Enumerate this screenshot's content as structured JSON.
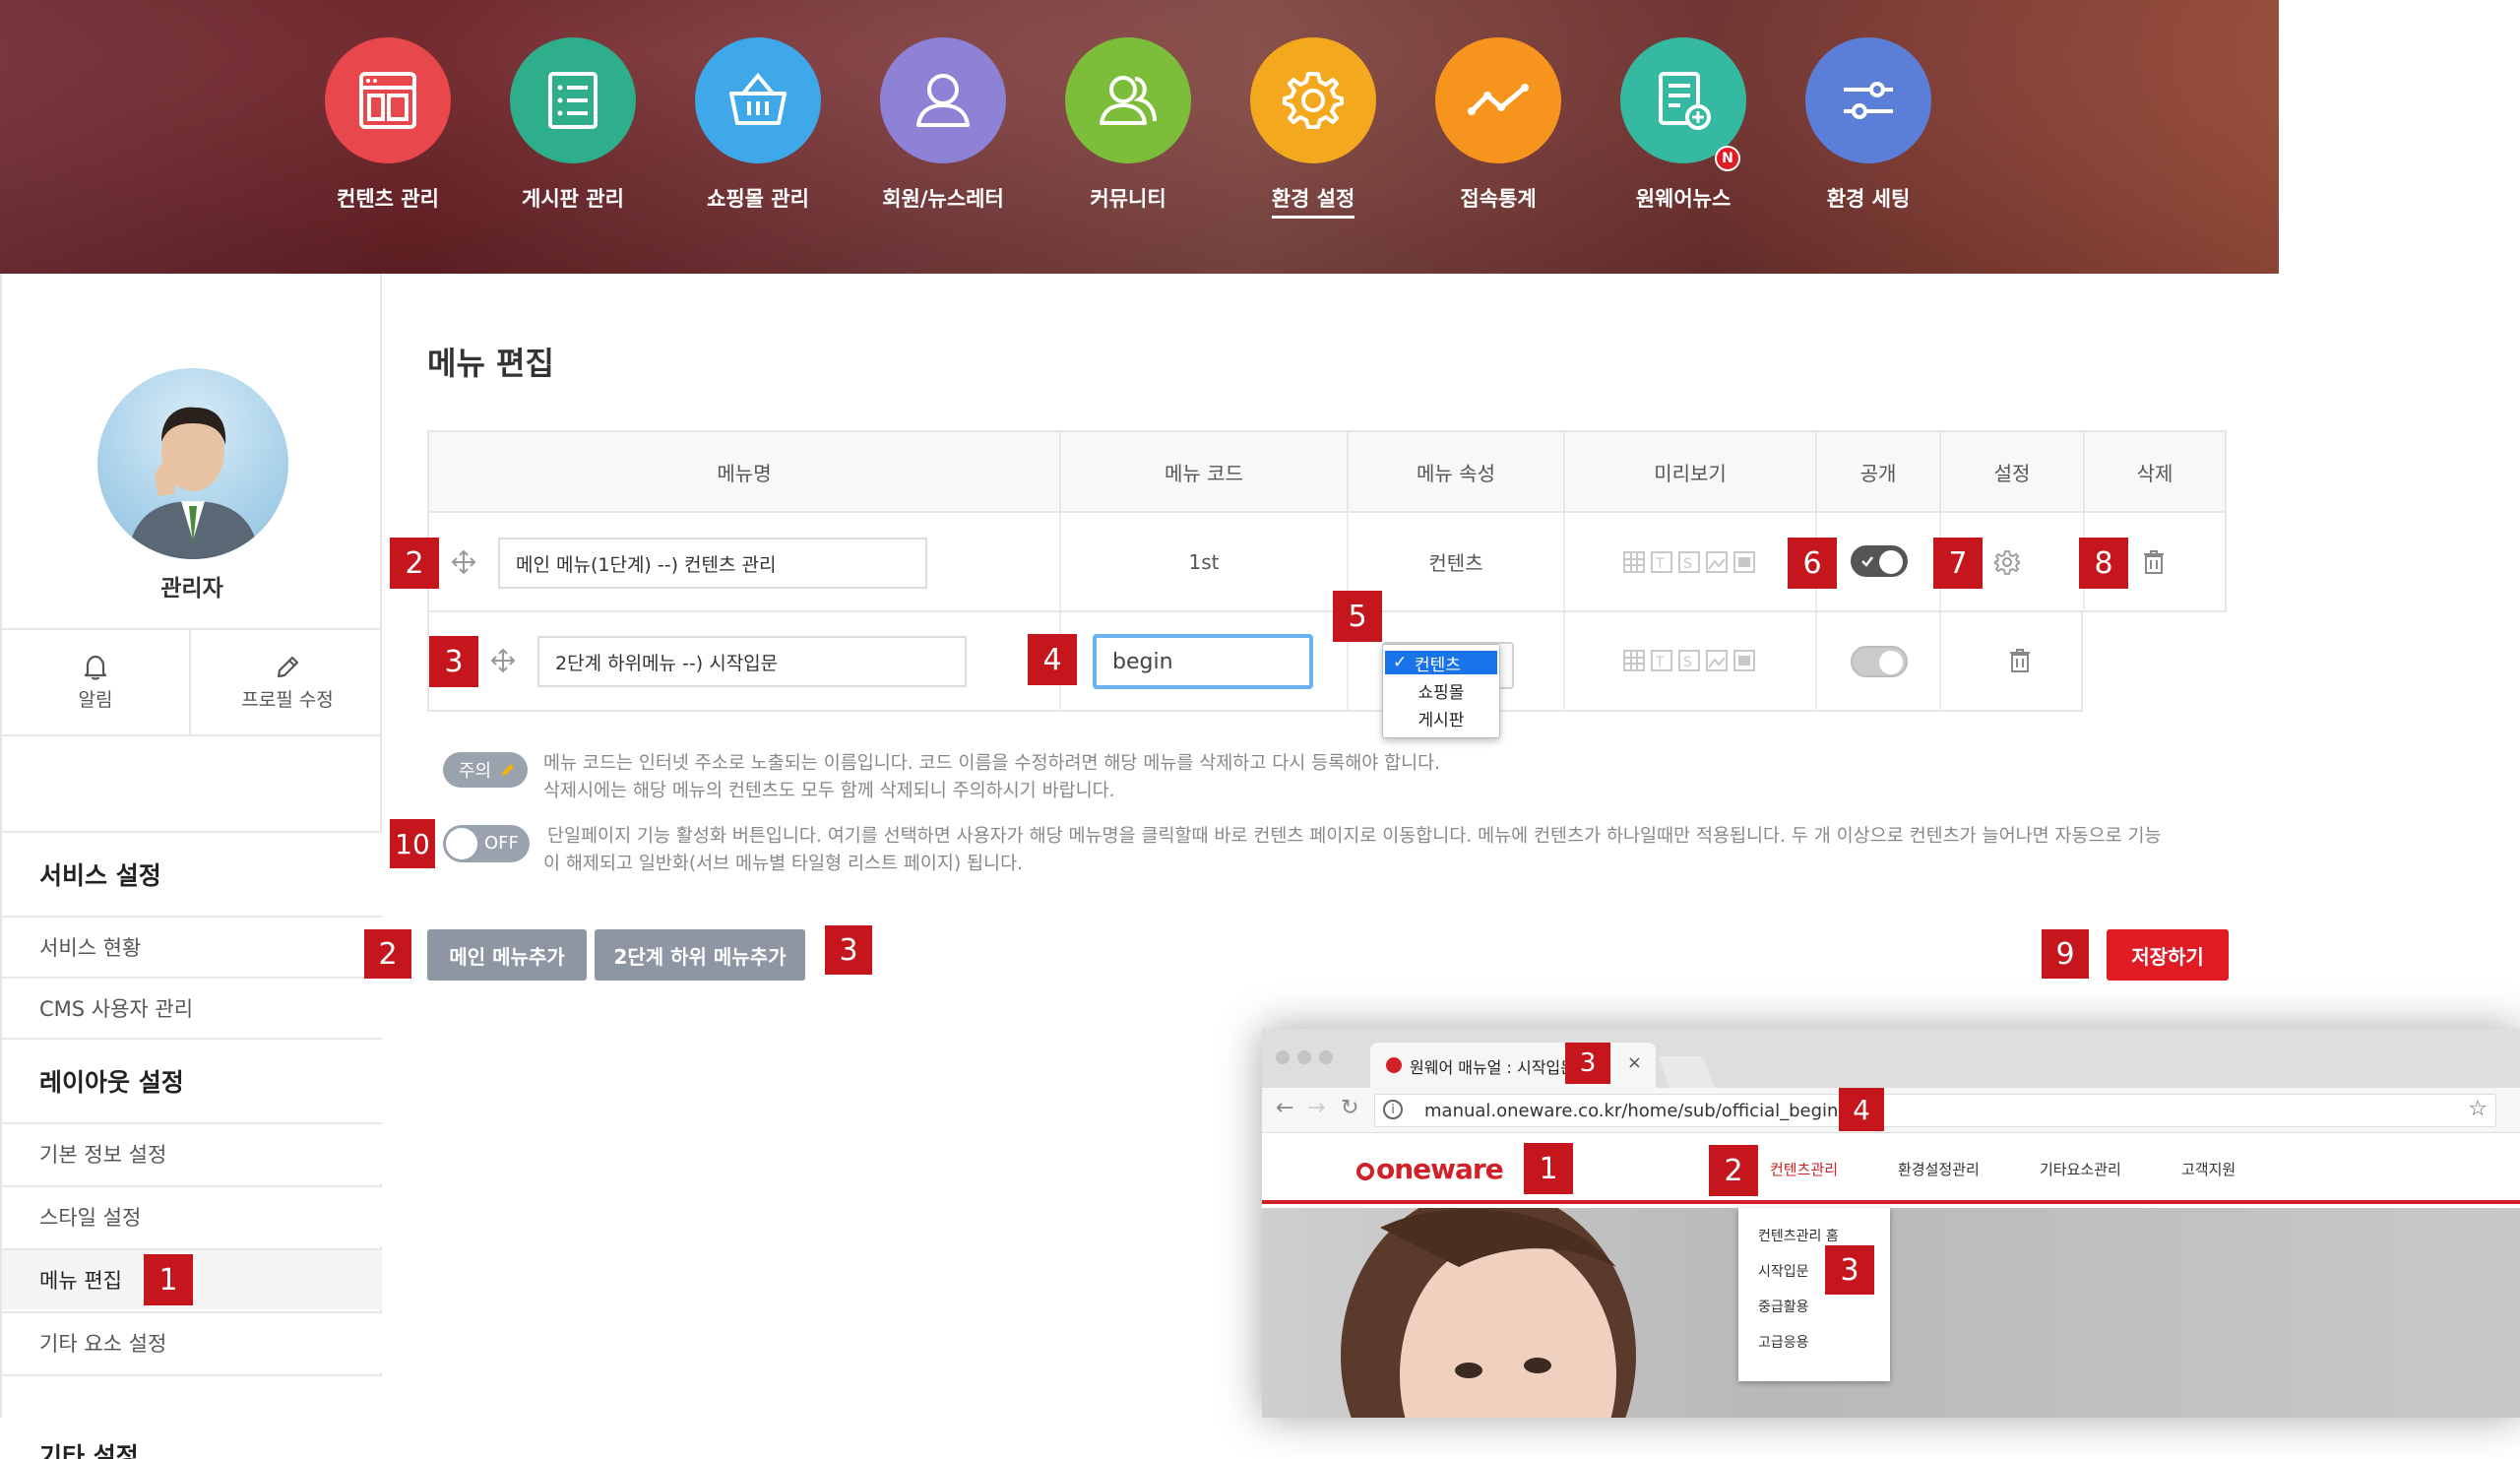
{
  "nav": {
    "items": [
      {
        "label": "컨텐츠 관리",
        "icon": "layout-icon",
        "color": "#e8474b"
      },
      {
        "label": "게시판 관리",
        "icon": "list-icon",
        "color": "#2fae8c"
      },
      {
        "label": "쇼핑몰 관리",
        "icon": "basket-icon",
        "color": "#3ea8e8"
      },
      {
        "label": "회원/뉴스레터",
        "icon": "user-icon",
        "color": "#8d82d6"
      },
      {
        "label": "커뮤니티",
        "icon": "users-icon",
        "color": "#7cbd3a"
      },
      {
        "label": "환경 설정",
        "icon": "gear-icon",
        "color": "#f4a81d",
        "active": true
      },
      {
        "label": "접속통계",
        "icon": "stats-icon",
        "color": "#f7941d"
      },
      {
        "label": "원웨어뉴스",
        "icon": "news-icon",
        "color": "#35b9a0",
        "badge": "N"
      },
      {
        "label": "환경 세팅",
        "icon": "sliders-icon",
        "color": "#5b7fd8"
      }
    ]
  },
  "sidebar": {
    "username": "관리자",
    "actions": {
      "alarm": "알림",
      "profile": "프로필 수정"
    },
    "groups": [
      {
        "title": "서비스 설정",
        "items": [
          "서비스 현황",
          "CMS 사용자 관리"
        ]
      },
      {
        "title": "레이아웃 설정",
        "items": [
          "기본 정보 설정",
          "스타일 설정",
          "메뉴 편집",
          "기타 요소 설정"
        ]
      },
      {
        "title": "기타 설정"
      }
    ],
    "current_badge": "1"
  },
  "main": {
    "title": "메뉴 편집",
    "columns": [
      "메뉴명",
      "메뉴 코드",
      "메뉴 속성",
      "미리보기",
      "공개",
      "설정",
      "삭제"
    ],
    "rows": [
      {
        "badge": "2",
        "name": "메인 메뉴(1단계)  --) 컨텐츠 관리",
        "code": "1st",
        "attr": "컨텐츠",
        "toggle_badge": "6",
        "settings_badge": "7",
        "delete_badge": "8"
      },
      {
        "badge": "3",
        "name": "2단계 하위메뉴  --) 시작입문",
        "code_badge": "4",
        "code_value": "begin",
        "attr_badge": "5"
      }
    ],
    "dropdown": {
      "options": [
        "컨텐츠",
        "쇼핑몰",
        "게시판"
      ],
      "selected": "컨텐츠"
    },
    "notice": {
      "tag": "주의",
      "line1": "메뉴 코드는 인터넷 주소로 노출되는 이름입니다. 코드 이름을 수정하려면 해당 메뉴를 삭제하고 다시 등록해야 합니다.",
      "line2": "삭제시에는 해당 메뉴의 컨텐츠도 모두 함께 삭제되니 주의하시기 바랍니다."
    },
    "single_page": {
      "badge": "10",
      "toggle_label": "OFF",
      "line1": "단일페이지 기능 활성화 버튼입니다. 여기를 선택하면 사용자가 해당 메뉴명을 클릭할때 바로 컨텐츠 페이지로 이동합니다. 메뉴에 컨텐츠가 하나일때만 적용됩니다. 두 개 이상으로 컨텐츠가 늘어나면 자동으로 기능",
      "line2": "이 해제되고 일반화(서브 메뉴별 타일형 리스트 페이지) 됩니다."
    },
    "buttons": {
      "add_main": "메인 메뉴추가",
      "add_sub": "2단계 하위 메뉴추가",
      "save": "저장하기",
      "add_main_badge": "2",
      "add_sub_badge": "3",
      "save_badge": "9"
    }
  },
  "browser": {
    "tab_title": "원웨어 매뉴얼 : 시작입문",
    "tab_badge": "3",
    "url": "manual.oneware.co.kr/home/sub/official_begin",
    "url_badge": "4",
    "logo": "oneware",
    "logo_badge": "1",
    "nav": [
      "컨텐츠관리",
      "환경설정관리",
      "기타요소관리",
      "고객지원"
    ],
    "nav_badge": "2",
    "submenu": [
      "컨텐츠관리 홈",
      "시작입문",
      "중급활용",
      "고급응용"
    ],
    "submenu_badge": "3"
  },
  "colors": {
    "accent_red": "#c4161c",
    "button_red": "#e01b24",
    "button_gray": "#8e96a3"
  }
}
